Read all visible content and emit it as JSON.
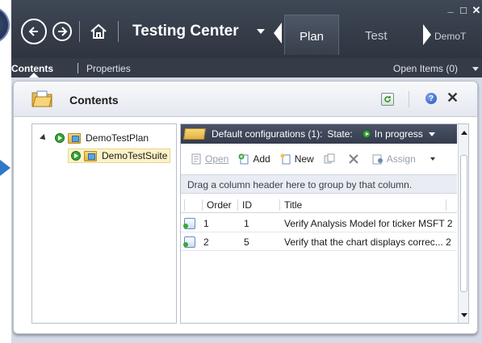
{
  "titlebar": {
    "app_title": "Testing Center",
    "tabs": [
      {
        "label": "Plan",
        "active": true
      },
      {
        "label": "Test",
        "active": false
      },
      {
        "label": "DemoT",
        "active": false
      }
    ],
    "window_controls": {
      "minimize": "_",
      "maximize": "□",
      "close": "✕"
    }
  },
  "subnav": {
    "contents_label": "Contents",
    "properties_label": "Properties",
    "open_items_label": "Open Items (0)"
  },
  "panel": {
    "title": "Contents",
    "help_label": "?",
    "close_label": "✕"
  },
  "tree": {
    "items": [
      {
        "label": "DemoTestPlan",
        "icon": "folder-icon",
        "status": "in-progress"
      },
      {
        "label": "DemoTestSuite",
        "icon": "folder-icon",
        "status": "in-progress",
        "selected": true
      }
    ]
  },
  "grid": {
    "header": {
      "configurations": "Default configurations (1):",
      "state_label": "State:",
      "state_value": "In progress"
    },
    "toolbar": [
      {
        "label": "Open",
        "enabled": false,
        "icon": "open-icon"
      },
      {
        "label": "Add",
        "enabled": true,
        "icon": "add-icon"
      },
      {
        "label": "New",
        "enabled": true,
        "icon": "new-icon"
      },
      {
        "label": "",
        "enabled": false,
        "icon": "copy-icon"
      },
      {
        "label": "",
        "enabled": false,
        "icon": "remove-icon"
      },
      {
        "label": "Assign",
        "enabled": false,
        "icon": "assign-icon"
      }
    ],
    "group_hint": "Drag a column header here to group by that column.",
    "columns": [
      "Order",
      "ID",
      "Title"
    ],
    "rows": [
      {
        "order": "1",
        "id": "1",
        "title": "Verify Analysis Model for ticker MSFT 2"
      },
      {
        "order": "2",
        "id": "5",
        "title": "Verify that the chart displays correc... 2"
      }
    ]
  },
  "colors": {
    "titlebar": "#353c47",
    "accent_green": "#3aa53a",
    "selection": "#fdf3c8"
  }
}
